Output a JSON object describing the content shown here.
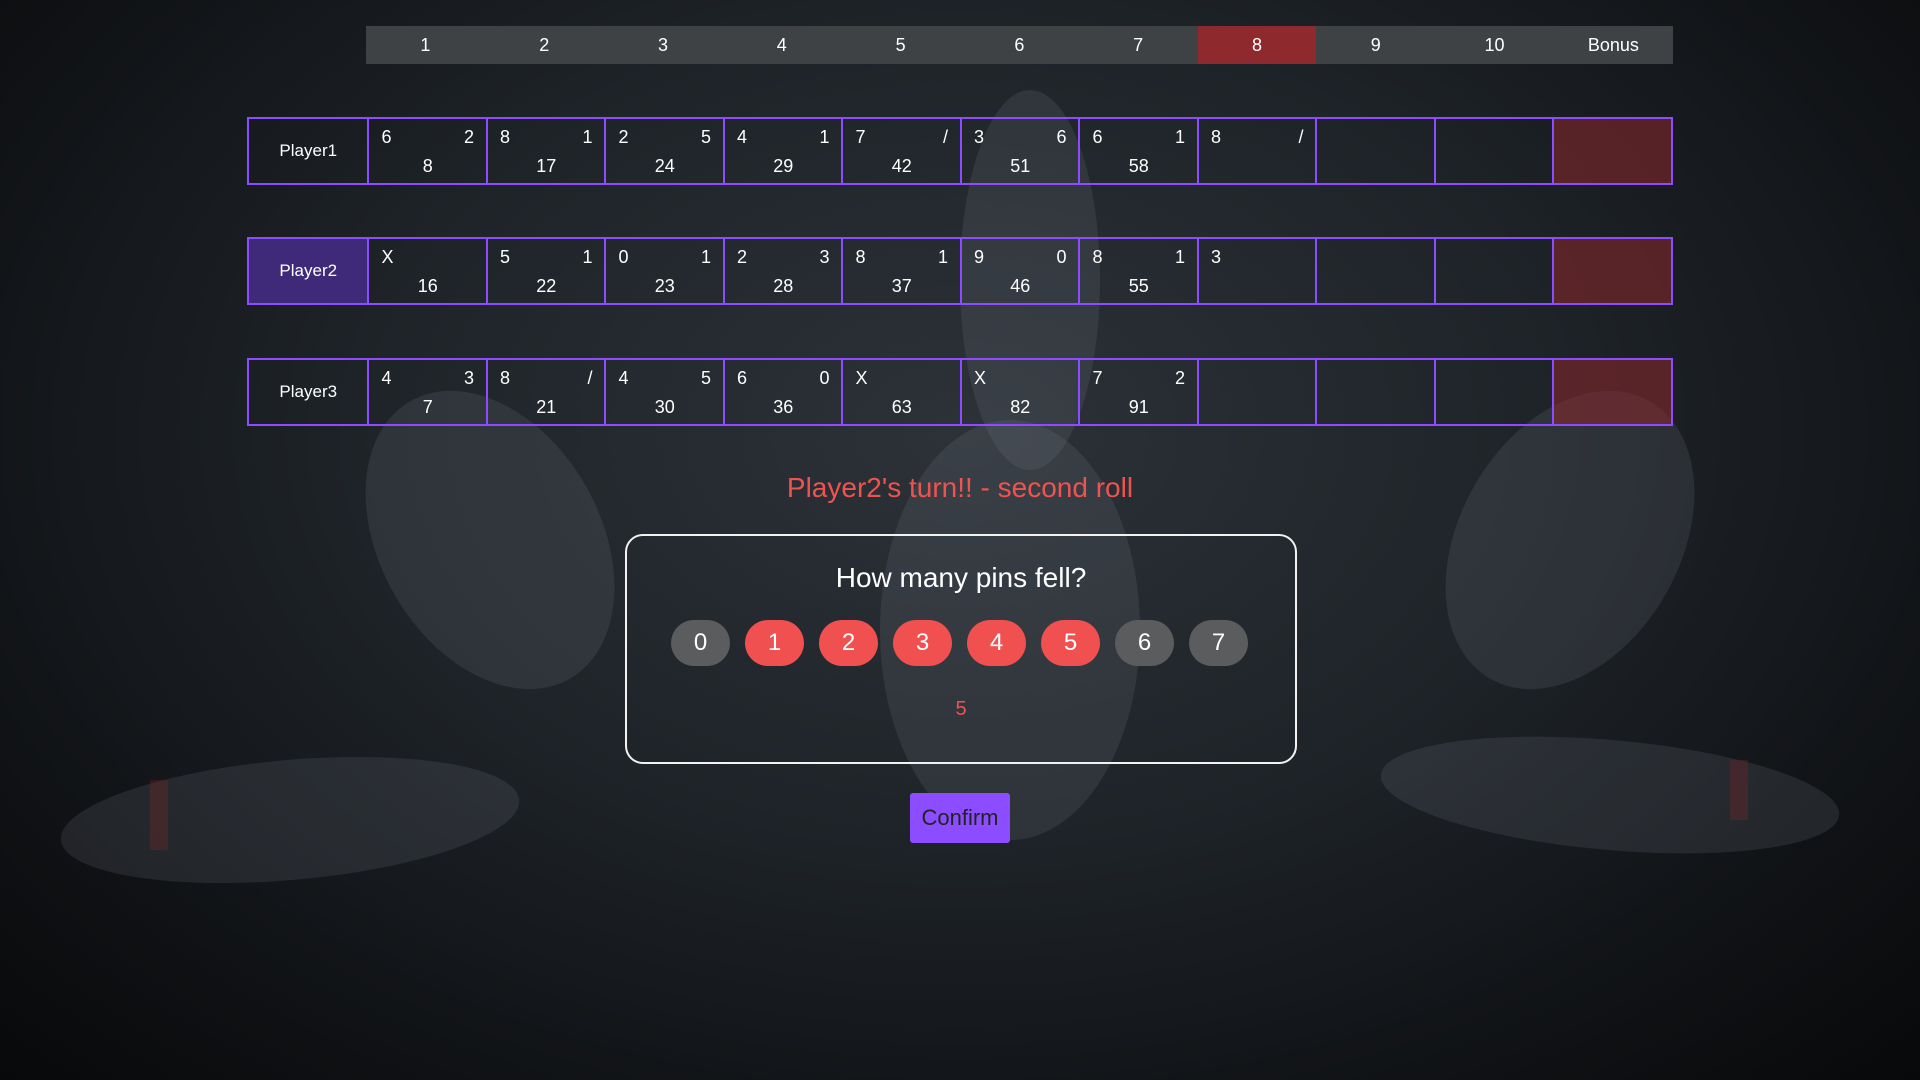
{
  "header": {
    "frames": [
      "1",
      "2",
      "3",
      "4",
      "5",
      "6",
      "7",
      "8",
      "9",
      "10",
      "Bonus"
    ],
    "active_frame": "8",
    "active_color": "#8e2a2e"
  },
  "players": [
    {
      "name": "Player1",
      "current": false,
      "frames": [
        {
          "r1": "6",
          "r2": "2",
          "total": "8"
        },
        {
          "r1": "8",
          "r2": "1",
          "total": "17"
        },
        {
          "r1": "2",
          "r2": "5",
          "total": "24"
        },
        {
          "r1": "4",
          "r2": "1",
          "total": "29"
        },
        {
          "r1": "7",
          "r2": "/",
          "total": "42"
        },
        {
          "r1": "3",
          "r2": "6",
          "total": "51"
        },
        {
          "r1": "6",
          "r2": "1",
          "total": "58"
        },
        {
          "r1": "8",
          "r2": "/",
          "total": ""
        },
        {
          "r1": "",
          "r2": "",
          "total": ""
        },
        {
          "r1": "",
          "r2": "",
          "total": ""
        },
        {
          "r1": "",
          "r2": "",
          "total": ""
        }
      ]
    },
    {
      "name": "Player2",
      "current": true,
      "frames": [
        {
          "r1": "X",
          "r2": "",
          "total": "16"
        },
        {
          "r1": "5",
          "r2": "1",
          "total": "22"
        },
        {
          "r1": "0",
          "r2": "1",
          "total": "23"
        },
        {
          "r1": "2",
          "r2": "3",
          "total": "28"
        },
        {
          "r1": "8",
          "r2": "1",
          "total": "37"
        },
        {
          "r1": "9",
          "r2": "0",
          "total": "46"
        },
        {
          "r1": "8",
          "r2": "1",
          "total": "55"
        },
        {
          "r1": "3",
          "r2": "",
          "total": ""
        },
        {
          "r1": "",
          "r2": "",
          "total": ""
        },
        {
          "r1": "",
          "r2": "",
          "total": ""
        },
        {
          "r1": "",
          "r2": "",
          "total": ""
        }
      ]
    },
    {
      "name": "Player3",
      "current": false,
      "frames": [
        {
          "r1": "4",
          "r2": "3",
          "total": "7"
        },
        {
          "r1": "8",
          "r2": "/",
          "total": "21"
        },
        {
          "r1": "4",
          "r2": "5",
          "total": "30"
        },
        {
          "r1": "6",
          "r2": "0",
          "total": "36"
        },
        {
          "r1": "X",
          "r2": "",
          "total": "63"
        },
        {
          "r1": "X",
          "r2": "",
          "total": "82"
        },
        {
          "r1": "7",
          "r2": "2",
          "total": "91"
        },
        {
          "r1": "",
          "r2": "",
          "total": ""
        },
        {
          "r1": "",
          "r2": "",
          "total": ""
        },
        {
          "r1": "",
          "r2": "",
          "total": ""
        },
        {
          "r1": "",
          "r2": "",
          "total": ""
        }
      ]
    }
  ],
  "turn_message": "Player2's turn!! - second roll",
  "pin_dialog": {
    "title": "How many pins fell?",
    "options": [
      {
        "label": "0",
        "highlight": false
      },
      {
        "label": "1",
        "highlight": true
      },
      {
        "label": "2",
        "highlight": true
      },
      {
        "label": "3",
        "highlight": true
      },
      {
        "label": "4",
        "highlight": true
      },
      {
        "label": "5",
        "highlight": true
      },
      {
        "label": "6",
        "highlight": false
      },
      {
        "label": "7",
        "highlight": false
      }
    ],
    "selected_value": "5"
  },
  "confirm_label": "Confirm",
  "colors": {
    "accent": "#8b4dff",
    "highlight": "#f05050",
    "message": "#ef5350"
  }
}
